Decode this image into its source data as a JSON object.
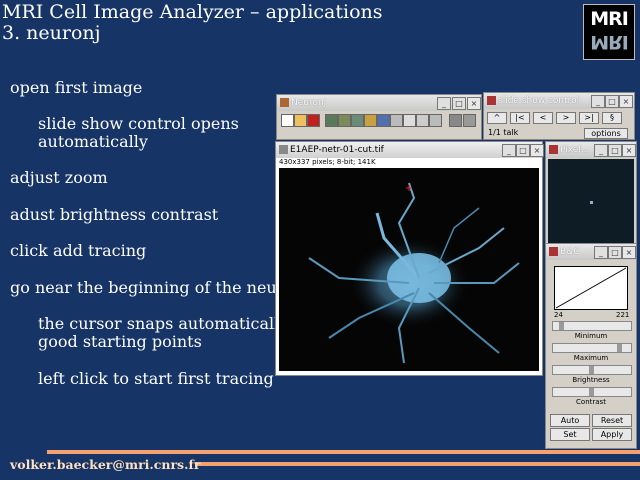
{
  "title": {
    "line1": "MRI Cell Image Analyzer – applications",
    "line2": "3. neuronj"
  },
  "logo": {
    "top": "MRI",
    "bottom": "MRI"
  },
  "bullets": [
    "open first image",
    "slide show control opens",
    "automatically",
    "adjust zoom",
    "adust brightness contrast",
    "click add tracing",
    "go near the beginning of the neurite",
    "the cursor snaps automatically to",
    "good starting points",
    "left click to start first tracing"
  ],
  "footer": {
    "email": "volker.baecker@mri.cnrs.fr"
  },
  "neuronj": {
    "title": "NeuronJ"
  },
  "slideshow": {
    "title": "slide show control",
    "buttons": [
      "^",
      "|<",
      "<",
      ">",
      ">|",
      "§"
    ],
    "count": "1/1 talk",
    "options": "options"
  },
  "image": {
    "title": "E1AEP-netr-01-cut.tif",
    "info": "430x337 pixels; 8-bit; 141K"
  },
  "pixel": {
    "title": "Pixel..."
  },
  "bc": {
    "title": "B&C",
    "min_val": "24",
    "max_val": "221",
    "labels": [
      "Minimum",
      "Maximum",
      "Brightness",
      "Contrast"
    ],
    "auto": "Auto",
    "reset": "Reset",
    "set": "Set",
    "apply": "Apply"
  },
  "colors": {
    "background": "#163466",
    "accent": "#f4a070"
  }
}
